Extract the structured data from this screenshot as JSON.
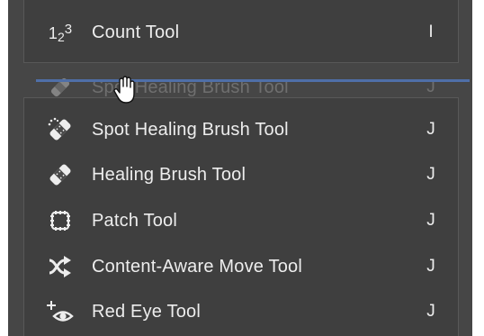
{
  "menu": {
    "count_tool": {
      "label": "Count Tool",
      "shortcut": "I",
      "icon": "count-icon",
      "icon_text_1": "1",
      "icon_text_2": "2",
      "icon_text_3": "3"
    },
    "dragging_item": {
      "label": "Spot Healing Brush Tool",
      "shortcut": "J",
      "icon": "spot-healing-brush-icon"
    },
    "items": [
      {
        "label": "Spot Healing Brush Tool",
        "shortcut": "J",
        "icon": "spot-healing-brush-icon"
      },
      {
        "label": "Healing Brush Tool",
        "shortcut": "J",
        "icon": "healing-brush-icon"
      },
      {
        "label": "Patch Tool",
        "shortcut": "J",
        "icon": "patch-icon"
      },
      {
        "label": "Content-Aware Move Tool",
        "shortcut": "J",
        "icon": "content-aware-move-icon"
      },
      {
        "label": "Red Eye Tool",
        "shortcut": "J",
        "icon": "red-eye-icon"
      }
    ]
  },
  "colors": {
    "panel_bg": "#464646",
    "group_bg": "#3f3f3f",
    "text": "#ededed",
    "drop_indicator": "#4f6fa8"
  }
}
